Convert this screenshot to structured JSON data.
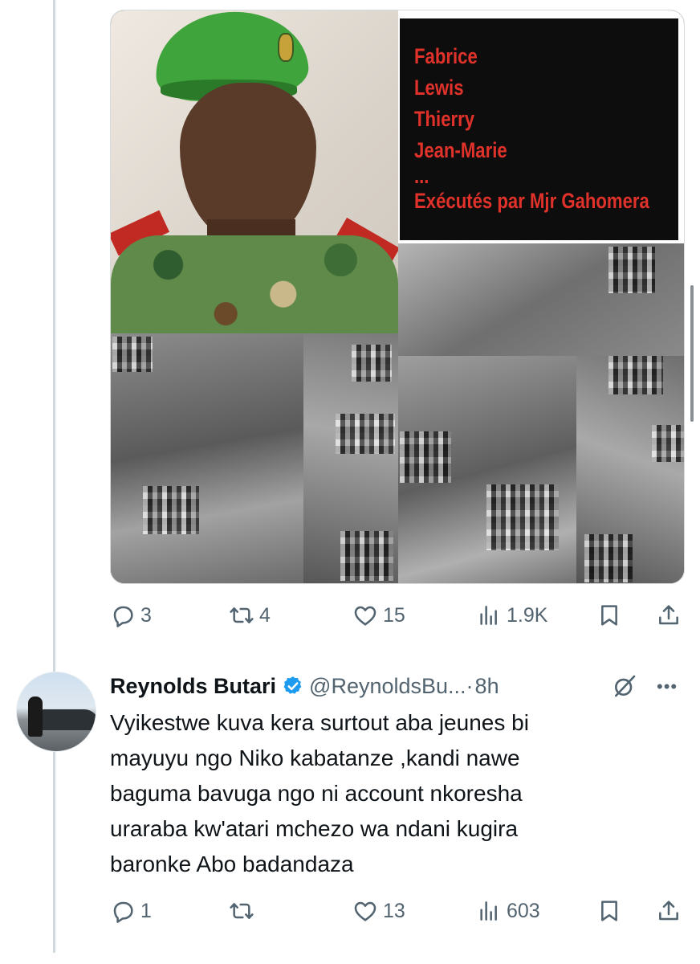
{
  "media_overlay": {
    "names": [
      "Fabrice",
      "Lewis",
      "Thierry",
      "Jean-Marie",
      "...",
      "Exécutés par Mjr Gahomera"
    ]
  },
  "tweet_actions": {
    "replies": "3",
    "retweets": "4",
    "likes": "15",
    "views": "1.9K"
  },
  "reply": {
    "display_name": "Reynolds Butari",
    "handle": "@ReynoldsBu...",
    "dot": "·",
    "time": "8h",
    "text_lines": [
      "Vyikestwe kuva kera surtout aba jeunes bi",
      "mayuyu ngo Niko kabatanze ,kandi nawe",
      "baguma bavuga ngo ni account nkoresha",
      "uraraba kw'atari mchezo wa ndani kugira",
      "baronke Abo badandaza"
    ],
    "actions": {
      "replies": "1",
      "retweets": "",
      "likes": "13",
      "views": "603"
    }
  },
  "icons": {
    "reply": "reply-icon",
    "retweet": "retweet-icon",
    "like": "heart-icon",
    "views": "views-icon",
    "bookmark": "bookmark-icon",
    "share": "share-icon",
    "verified": "verified-badge-icon",
    "grok": "grok-icon",
    "more": "more-icon"
  },
  "colors": {
    "overlay_text": "#e0322a",
    "overlay_bg": "#0d0d0d",
    "secondary_text": "#536471",
    "verified": "#1d9bf0"
  }
}
